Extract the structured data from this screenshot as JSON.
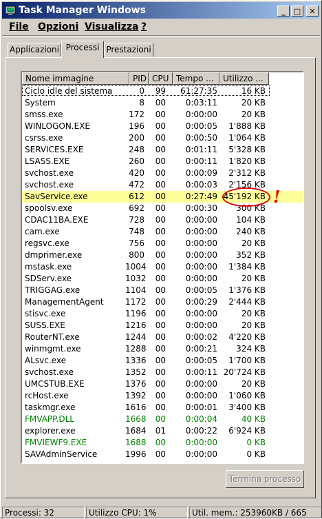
{
  "window": {
    "title": "Task Manager Windows",
    "buttons": {
      "minimize": "_",
      "maximize": "□",
      "close": "✕"
    }
  },
  "menu": [
    "File",
    "Opzioni",
    "Visualizza",
    "?"
  ],
  "tabs": [
    "Applicazioni",
    "Processi",
    "Prestazioni"
  ],
  "active_tab": "Processi",
  "columns": [
    "Nome immagine",
    "PID",
    "CPU",
    "Tempo ...",
    "Utilizzo ..."
  ],
  "processes": [
    {
      "name": "Ciclo idle del sistema",
      "pid": "0",
      "cpu": "99",
      "time": "61:27:35",
      "mem": "16 KB"
    },
    {
      "name": "System",
      "pid": "8",
      "cpu": "00",
      "time": "0:03:11",
      "mem": "20 KB"
    },
    {
      "name": "smss.exe",
      "pid": "172",
      "cpu": "00",
      "time": "0:00:00",
      "mem": "20 KB"
    },
    {
      "name": "WINLOGON.EXE",
      "pid": "196",
      "cpu": "00",
      "time": "0:00:05",
      "mem": "1'888 KB"
    },
    {
      "name": "csrss.exe",
      "pid": "200",
      "cpu": "00",
      "time": "0:00:50",
      "mem": "1'064 KB"
    },
    {
      "name": "SERVICES.EXE",
      "pid": "248",
      "cpu": "00",
      "time": "0:01:11",
      "mem": "5'328 KB"
    },
    {
      "name": "LSASS.EXE",
      "pid": "260",
      "cpu": "00",
      "time": "0:00:11",
      "mem": "1'820 KB"
    },
    {
      "name": "svchost.exe",
      "pid": "420",
      "cpu": "00",
      "time": "0:00:09",
      "mem": "2'312 KB"
    },
    {
      "name": "svchost.exe",
      "pid": "472",
      "cpu": "00",
      "time": "0:00:03",
      "mem": "2'156 KB"
    },
    {
      "name": "SavService.exe",
      "pid": "612",
      "cpu": "00",
      "time": "0:27:49",
      "mem": "45'192 KB",
      "highlight": true
    },
    {
      "name": "spoolsv.exe",
      "pid": "692",
      "cpu": "00",
      "time": "0:00:30",
      "mem": "300 KB"
    },
    {
      "name": "CDAC11BA.EXE",
      "pid": "728",
      "cpu": "00",
      "time": "0:00:00",
      "mem": "104 KB"
    },
    {
      "name": "cam.exe",
      "pid": "748",
      "cpu": "00",
      "time": "0:00:00",
      "mem": "240 KB"
    },
    {
      "name": "regsvc.exe",
      "pid": "756",
      "cpu": "00",
      "time": "0:00:00",
      "mem": "20 KB"
    },
    {
      "name": "dmprimer.exe",
      "pid": "800",
      "cpu": "00",
      "time": "0:00:00",
      "mem": "352 KB"
    },
    {
      "name": "mstask.exe",
      "pid": "1004",
      "cpu": "00",
      "time": "0:00:00",
      "mem": "1'384 KB"
    },
    {
      "name": "SDServ.exe",
      "pid": "1032",
      "cpu": "00",
      "time": "0:00:00",
      "mem": "20 KB"
    },
    {
      "name": "TRIGGAG.exe",
      "pid": "1104",
      "cpu": "00",
      "time": "0:00:05",
      "mem": "1'376 KB"
    },
    {
      "name": "ManagementAgent",
      "pid": "1172",
      "cpu": "00",
      "time": "0:00:29",
      "mem": "2'444 KB"
    },
    {
      "name": "stisvc.exe",
      "pid": "1196",
      "cpu": "00",
      "time": "0:00:00",
      "mem": "20 KB"
    },
    {
      "name": "SUSS.EXE",
      "pid": "1216",
      "cpu": "00",
      "time": "0:00:00",
      "mem": "20 KB"
    },
    {
      "name": "RouterNT.exe",
      "pid": "1244",
      "cpu": "00",
      "time": "0:00:02",
      "mem": "4'220 KB"
    },
    {
      "name": "winmgmt.exe",
      "pid": "1288",
      "cpu": "00",
      "time": "0:00:21",
      "mem": "324 KB"
    },
    {
      "name": "ALsvc.exe",
      "pid": "1336",
      "cpu": "00",
      "time": "0:00:05",
      "mem": "1'700 KB"
    },
    {
      "name": "svchost.exe",
      "pid": "1352",
      "cpu": "00",
      "time": "0:00:11",
      "mem": "20'724 KB"
    },
    {
      "name": "UMCSTUB.EXE",
      "pid": "1376",
      "cpu": "00",
      "time": "0:00:00",
      "mem": "20 KB"
    },
    {
      "name": "rcHost.exe",
      "pid": "1392",
      "cpu": "00",
      "time": "0:00:00",
      "mem": "1'060 KB"
    },
    {
      "name": "taskmgr.exe",
      "pid": "1616",
      "cpu": "00",
      "time": "0:00:01",
      "mem": "3'400 KB"
    },
    {
      "name": "FMVAPP.DLL",
      "pid": "1668",
      "cpu": "00",
      "time": "0:00:04",
      "mem": "40 KB",
      "green": true
    },
    {
      "name": "explorer.exe",
      "pid": "1684",
      "cpu": "01",
      "time": "0:00:22",
      "mem": "6'924 KB"
    },
    {
      "name": "FMVIEWF9.EXE",
      "pid": "1688",
      "cpu": "00",
      "time": "0:00:00",
      "mem": "0 KB",
      "green": true
    },
    {
      "name": "SAVAdminService",
      "pid": "1996",
      "cpu": "00",
      "time": "0:00:00",
      "mem": "0 KB"
    }
  ],
  "annotation": {
    "mark": "!",
    "color": "#e00000"
  },
  "end_process_button": "Termina processo",
  "status": {
    "processes": "Processi: 32",
    "cpu": "Utilizzo CPU: 1%",
    "memory": "Util. mem.: 253960KB / 665"
  },
  "colors": {
    "title_start": "#0a246a",
    "title_end": "#a6caf0",
    "highlight": "#ffff99",
    "green_text": "#008000",
    "face": "#d4d0c8"
  }
}
